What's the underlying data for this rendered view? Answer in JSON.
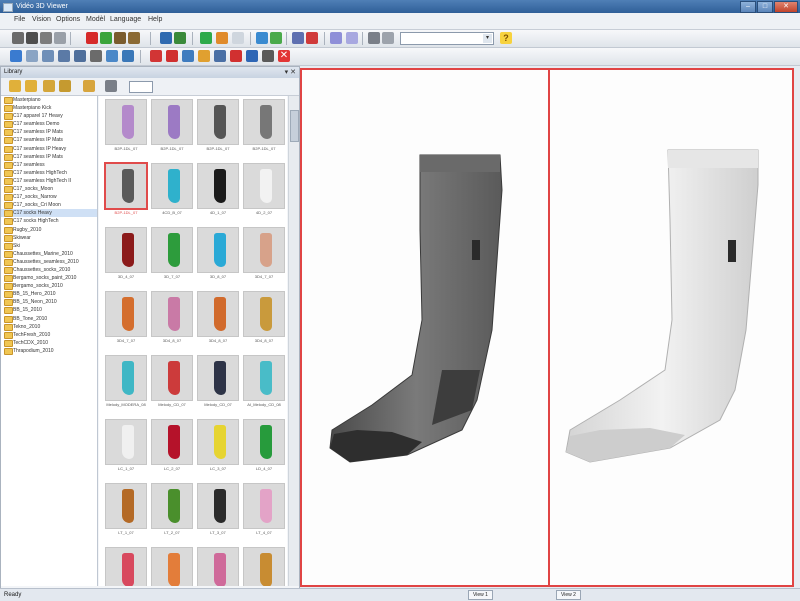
{
  "app": {
    "title": "Vidéo 3D Viewer",
    "menu": [
      "File",
      "Vision",
      "Options",
      "Modèl",
      "Language",
      "Help"
    ]
  },
  "toolbar": {
    "combo_value": "",
    "help_label": "?"
  },
  "panel": {
    "title": "Library",
    "controls": "▾ ✕"
  },
  "tree": {
    "items": [
      "Masterpiano",
      "Masterpiano Kick",
      "C17 apparel 17 Heavy",
      "C17 seamless Demo",
      "C17 seamless IP Mats",
      "C17 seamless IP Mats",
      "C17 seamless IP Heavy",
      "C17 seamless IP Mats",
      "C17 seamless",
      "C17 seamless HighTech",
      "C17 seamless HighTech II",
      "C17_socks_Moon",
      "C17_socks_Narrow",
      "C17_socks_Cri Moon",
      "C17 socks Heavy",
      "C17 socks HighTech",
      "Rugby_2010",
      "Skiwear",
      "Ski",
      "Chaussettes_Marine_2010",
      "Chaussettes_seamless_2010",
      "Chaussettes_socks_2010",
      "Bergamo_socks_paint_2010",
      "Bergamo_socks_2010",
      "BB_15_Hero_2010",
      "BB_15_Neon_2010",
      "BB_15_2010",
      "BB_Tone_2010",
      "Tekno_2010",
      "TechFresh_2010",
      "TechCDX_2010",
      "Thrapodium_2010"
    ]
  },
  "thumbnails": [
    {
      "label": "B2P-1DL_07",
      "color": "#b48acb"
    },
    {
      "label": "B2P-1DL_07",
      "color": "#9c7ac4"
    },
    {
      "label": "B2P-1DL_07",
      "color": "#555555"
    },
    {
      "label": "B2P-1DL_07",
      "color": "#777777"
    },
    {
      "label": "B2P-1DL_07",
      "color": "#5a5a5a",
      "selected": true
    },
    {
      "label": "4CD_B_07",
      "color": "#2fb1cc"
    },
    {
      "label": "4D_1_07",
      "color": "#1b1b1b"
    },
    {
      "label": "4D_2_07",
      "color": "#f2f2f2"
    },
    {
      "label": "3D_4_07",
      "color": "#8b1a1a"
    },
    {
      "label": "3D_7_07",
      "color": "#2d9c3c"
    },
    {
      "label": "3D_8_07",
      "color": "#2aa9d6"
    },
    {
      "label": "3D4_7_07",
      "color": "#d7a28a"
    },
    {
      "label": "3D4_7_07",
      "color": "#d46e2e"
    },
    {
      "label": "3D4_8_07",
      "color": "#c97aa6"
    },
    {
      "label": "3D4_8_07",
      "color": "#d16a2c"
    },
    {
      "label": "3D4_8_07",
      "color": "#c99a3c"
    },
    {
      "label": "Melody_MODERA_08",
      "color": "#3fb7c5"
    },
    {
      "label": "Melody_CD_07",
      "color": "#cc3b3b"
    },
    {
      "label": "Melody_CD_07",
      "color": "#2e3447"
    },
    {
      "label": "AI_Melody_CD_08",
      "color": "#49bcc8"
    },
    {
      "label": "LC_1_07",
      "color": "#f0f0f0"
    },
    {
      "label": "LC_2_07",
      "color": "#b5122a"
    },
    {
      "label": "LC_3_07",
      "color": "#e6d431"
    },
    {
      "label": "LD_4_07",
      "color": "#279b3c"
    },
    {
      "label": "LT_1_07",
      "color": "#b46a26"
    },
    {
      "label": "LT_2_07",
      "color": "#4a8f2c"
    },
    {
      "label": "LT_3_07",
      "color": "#2b2b2b"
    },
    {
      "label": "LT_4_07",
      "color": "#e3a3c7"
    },
    {
      "label": "",
      "color": "#d8495e"
    },
    {
      "label": "",
      "color": "#e37d3a"
    },
    {
      "label": "",
      "color": "#cf6a9a"
    },
    {
      "label": "",
      "color": "#c88c32"
    }
  ],
  "views": {
    "left_tab": "View 1",
    "right_tab": "View 2"
  },
  "status": {
    "text": "Ready"
  }
}
